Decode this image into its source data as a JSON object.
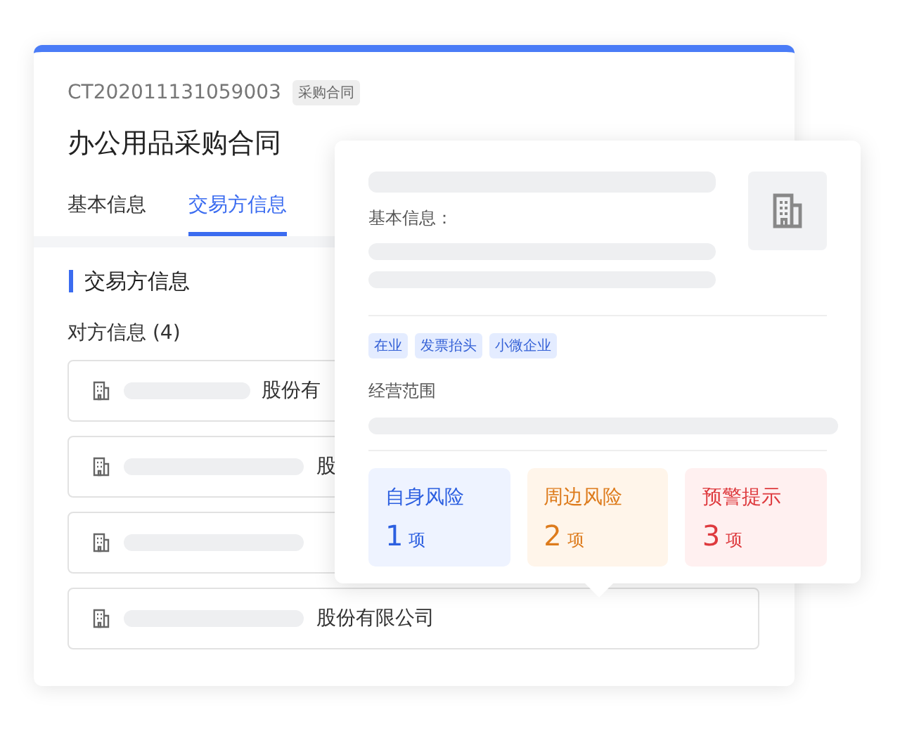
{
  "contract": {
    "id": "CT202011131059003",
    "type_tag": "采购合同",
    "title": "办公用品采购合同"
  },
  "tabs": [
    {
      "label": "基本信息",
      "selected": false
    },
    {
      "label": "交易方信息",
      "selected": true
    }
  ],
  "section_title": "交易方信息",
  "counterparty_heading": "对方信息 (4)",
  "counterparties": [
    {
      "name": "股份有",
      "kind": "short"
    },
    {
      "name": "股",
      "kind": "long"
    },
    {
      "kind": "long"
    },
    {
      "name": "股份有限公司",
      "kind": "long"
    }
  ],
  "popover": {
    "basic_info_label": "基本信息：",
    "tags": [
      "在业",
      "发票抬头",
      "小微企业"
    ],
    "scope_label": "经营范围",
    "risks": [
      {
        "label": "自身风险",
        "count": "1",
        "unit": "项",
        "kind": "self"
      },
      {
        "label": "周边风险",
        "count": "2",
        "unit": "项",
        "kind": "surrounding"
      },
      {
        "label": "预警提示",
        "count": "3",
        "unit": "项",
        "kind": "warning"
      }
    ]
  }
}
